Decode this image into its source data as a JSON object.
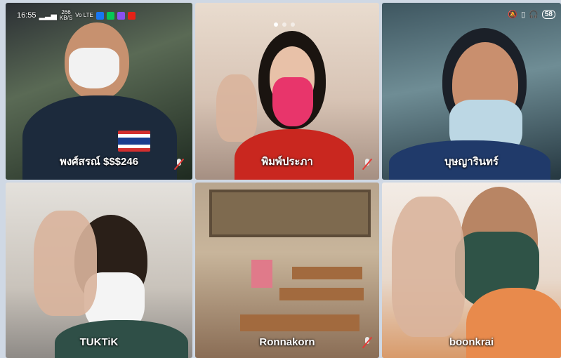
{
  "status_bar": {
    "time": "16:55",
    "network_speed": "266",
    "speed_unit": "KB/S",
    "network_type": "Vo LTE",
    "battery": "58"
  },
  "pager": {
    "pages": 3,
    "active": 1
  },
  "participants": [
    {
      "name": "พงศ์สรณ์ $$$246",
      "muted": true
    },
    {
      "name": "พิมพ์ประภา",
      "muted": true
    },
    {
      "name": "บุษญารินทร์",
      "muted": false
    },
    {
      "name": "TUKTiK",
      "muted": false
    },
    {
      "name": "Ronnakorn",
      "muted": true
    },
    {
      "name": "boonkrai",
      "muted": false
    }
  ],
  "colors": {
    "mask_pink": "#e8356b",
    "mask_white": "#f4f4f4",
    "mask_light_blue": "#bcd7e4",
    "mask_dark_green": "#2f5347",
    "muted_icon": "#e53935"
  }
}
